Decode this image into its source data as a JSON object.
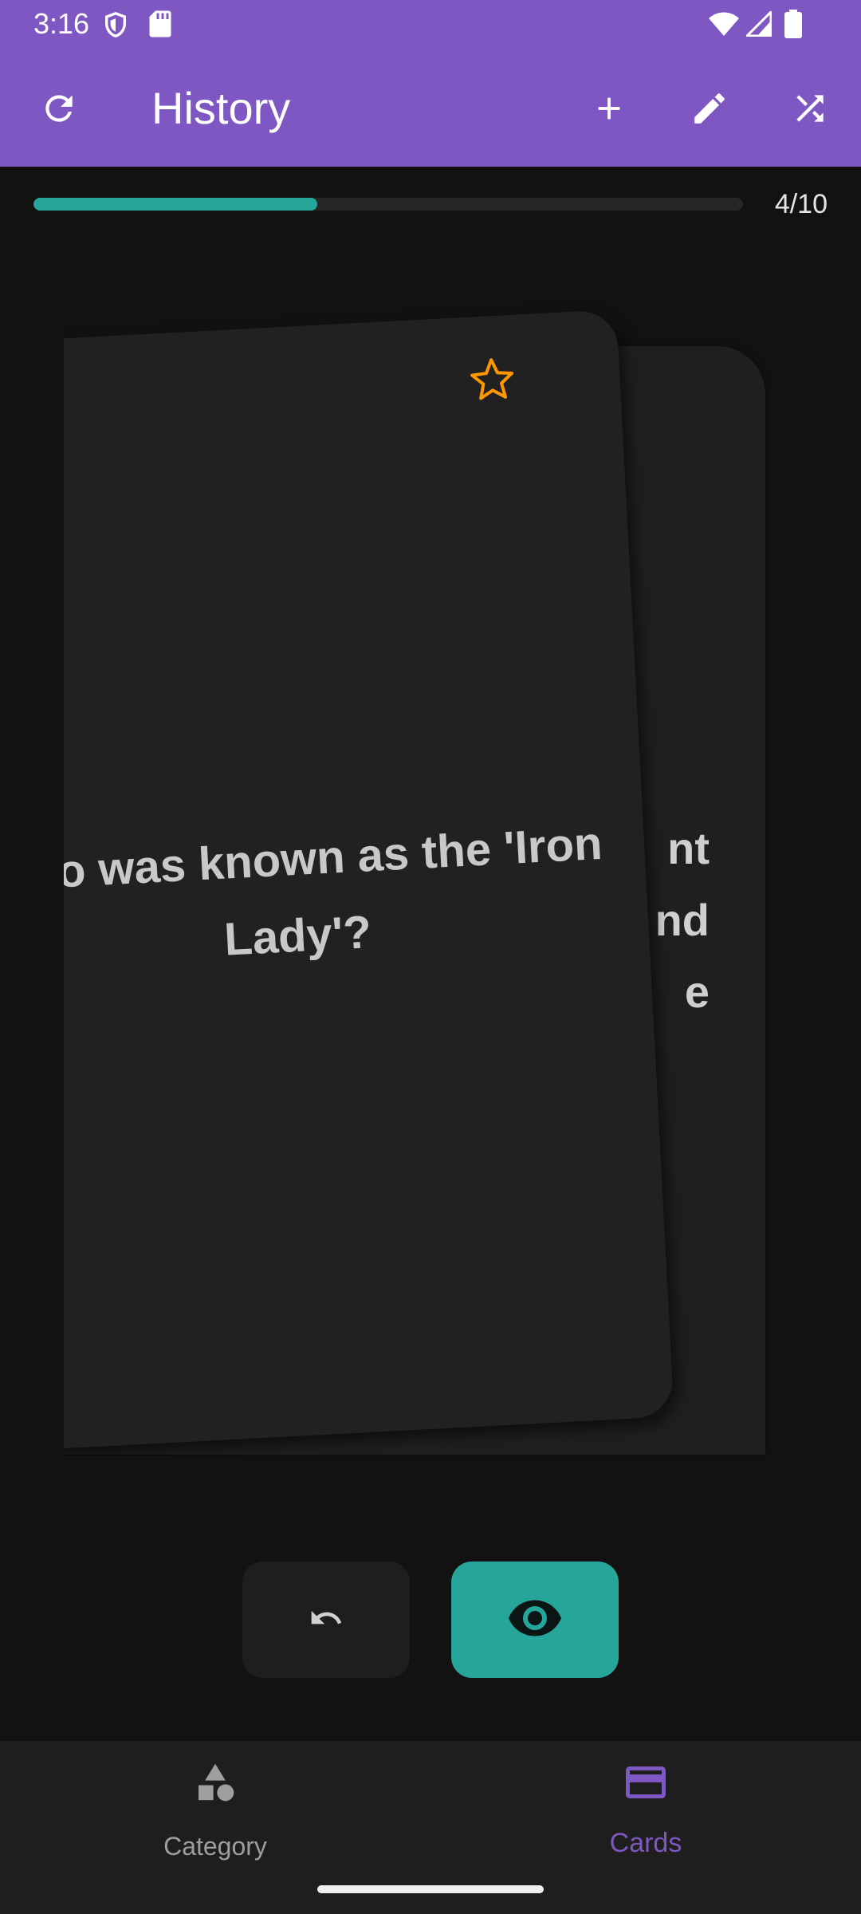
{
  "status_bar": {
    "time": "3:16"
  },
  "app_bar": {
    "title": "History",
    "background": "#7e57c2"
  },
  "progress": {
    "current": 4,
    "total": 10,
    "label": "4/10",
    "fill_fraction": 0.4,
    "color": "#26a69a"
  },
  "cards": {
    "front": {
      "question": "Who was known as the 'Iron Lady'?",
      "favorite": false
    },
    "back": {
      "partial_text": "nt\nnd\ne"
    }
  },
  "actions": {
    "undo_icon": "undo-icon",
    "reveal_icon": "eye-icon",
    "reveal_color": "#26a69a"
  },
  "bottom_nav": {
    "items": [
      {
        "label": "Category",
        "icon": "shapes-icon",
        "selected": false
      },
      {
        "label": "Cards",
        "icon": "card-icon",
        "selected": true
      }
    ],
    "selected_color": "#7e57c2",
    "unselected_color": "#9e9e9e"
  }
}
